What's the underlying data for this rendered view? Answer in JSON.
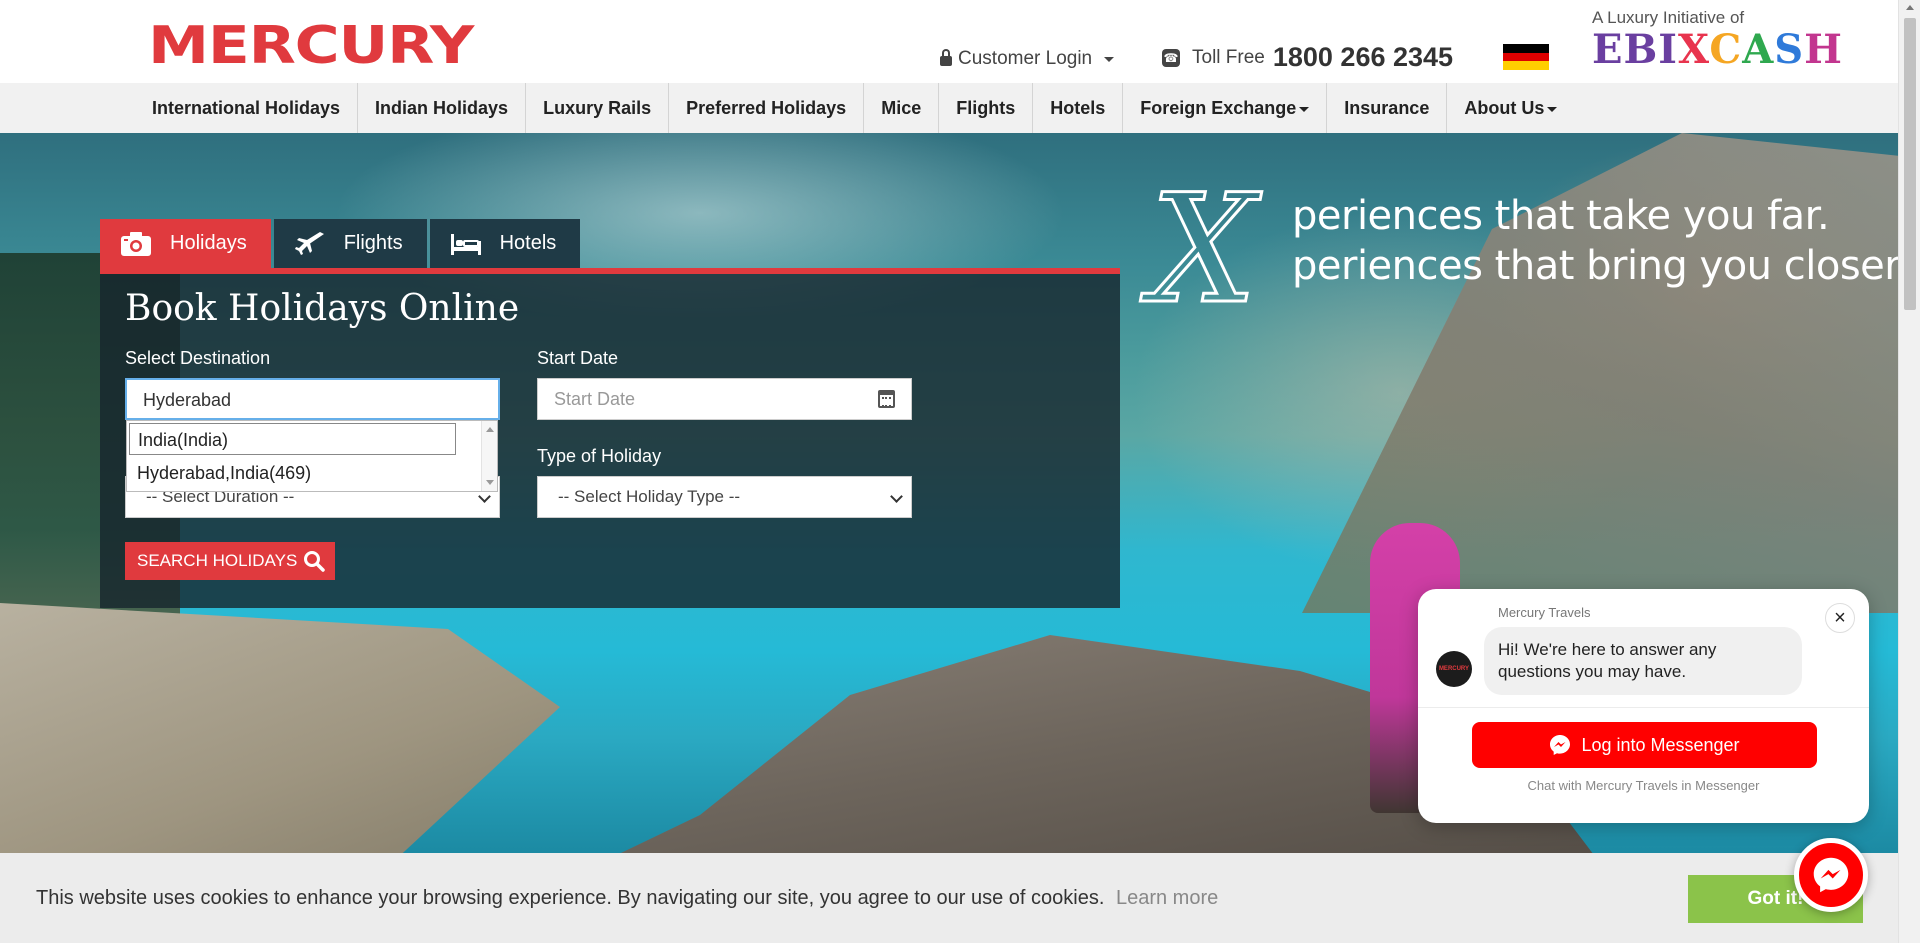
{
  "header": {
    "logo": "MERCURY",
    "customer_login": "Customer Login",
    "toll_free_label": "Toll Free",
    "toll_free_number": "1800 266 2345",
    "ebix_tagline": "A Luxury Initiative of",
    "ebix_name": "EBIXCASH"
  },
  "nav": {
    "items": [
      {
        "label": "International Holidays",
        "dropdown": false
      },
      {
        "label": "Indian Holidays",
        "dropdown": false
      },
      {
        "label": "Luxury Rails",
        "dropdown": false
      },
      {
        "label": "Preferred Holidays",
        "dropdown": false
      },
      {
        "label": "Mice",
        "dropdown": false
      },
      {
        "label": "Flights",
        "dropdown": false
      },
      {
        "label": "Hotels",
        "dropdown": false
      },
      {
        "label": "Foreign Exchange",
        "dropdown": true
      },
      {
        "label": "Insurance",
        "dropdown": false
      },
      {
        "label": "About Us",
        "dropdown": true
      }
    ]
  },
  "hero": {
    "tagline_x": "X",
    "tagline_line1": "periences that take you far.",
    "tagline_line2": "periences that bring you closer."
  },
  "booking": {
    "tabs": [
      "Holidays",
      "Flights",
      "Hotels"
    ],
    "active_tab": "Holidays",
    "title": "Book Holidays Online",
    "destination_label": "Select Destination",
    "destination_value": "Hyderabad",
    "start_date_label": "Start Date",
    "start_date_placeholder": "Start Date",
    "duration_value": "-- Select Duration --",
    "holiday_type_label": "Type of Holiday",
    "holiday_type_value": "-- Select Holiday Type --",
    "suggestions": [
      "India(India)",
      "Hyderabad,India(469)"
    ],
    "search_button": "SEARCH HOLIDAYS"
  },
  "chat": {
    "sender": "Mercury Travels",
    "avatar_text": "MERCURY",
    "message": "Hi! We're here to answer any questions you may have.",
    "button": "Log into Messenger",
    "footer": "Chat with Mercury Travels in Messenger",
    "close": "×"
  },
  "cookie": {
    "text": "This website uses cookies to enhance your browsing experience. By navigating our site, you agree to our use of cookies.",
    "learn_more": "Learn more",
    "accept": "Got it!"
  },
  "colors": {
    "brand_red": "#e03a3e",
    "nav_bg": "#f1f1f1",
    "tab_dark": "#1f3a46",
    "messenger_red": "#ff0000",
    "cookie_green": "#8bc34a"
  }
}
